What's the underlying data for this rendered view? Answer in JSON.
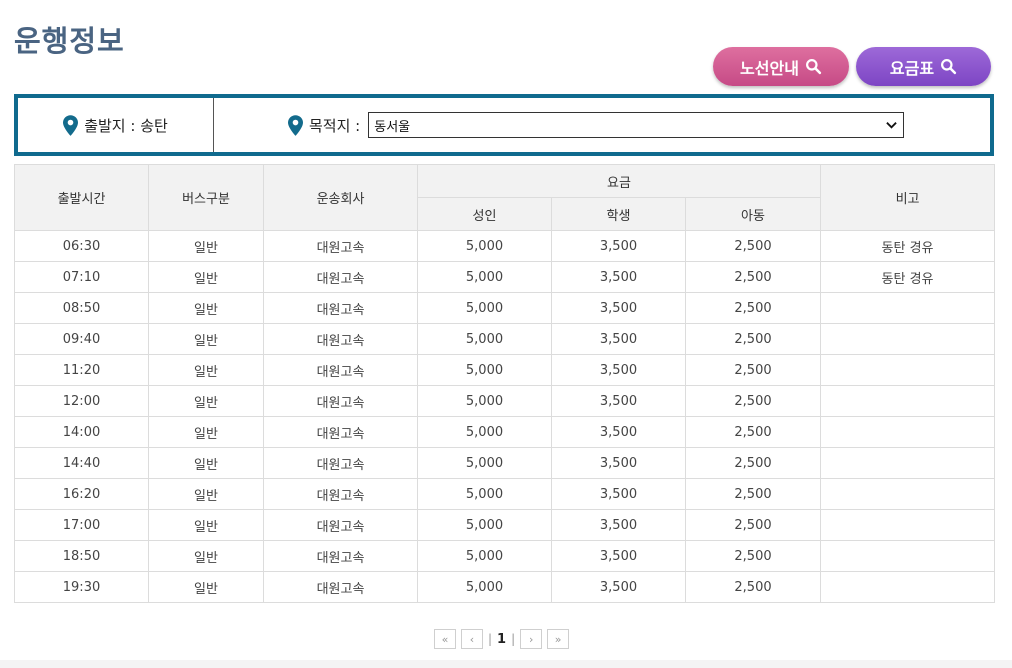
{
  "title": "운행정보",
  "buttons": {
    "route": "노선안내",
    "fare": "요금표"
  },
  "filter": {
    "departure_label": "출발지 : 송탄",
    "destination_label": "목적지 :",
    "destination_value": "동서울"
  },
  "table": {
    "headers": {
      "time": "출발시간",
      "bus_type": "버스구분",
      "company": "운송회사",
      "fare": "요금",
      "adult": "성인",
      "student": "학생",
      "child": "아동",
      "note": "비고"
    },
    "rows": [
      [
        "06:30",
        "일반",
        "대원고속",
        "5,000",
        "3,500",
        "2,500",
        "동탄 경유"
      ],
      [
        "07:10",
        "일반",
        "대원고속",
        "5,000",
        "3,500",
        "2,500",
        "동탄 경유"
      ],
      [
        "08:50",
        "일반",
        "대원고속",
        "5,000",
        "3,500",
        "2,500",
        ""
      ],
      [
        "09:40",
        "일반",
        "대원고속",
        "5,000",
        "3,500",
        "2,500",
        ""
      ],
      [
        "11:20",
        "일반",
        "대원고속",
        "5,000",
        "3,500",
        "2,500",
        ""
      ],
      [
        "12:00",
        "일반",
        "대원고속",
        "5,000",
        "3,500",
        "2,500",
        ""
      ],
      [
        "14:00",
        "일반",
        "대원고속",
        "5,000",
        "3,500",
        "2,500",
        ""
      ],
      [
        "14:40",
        "일반",
        "대원고속",
        "5,000",
        "3,500",
        "2,500",
        ""
      ],
      [
        "16:20",
        "일반",
        "대원고속",
        "5,000",
        "3,500",
        "2,500",
        ""
      ],
      [
        "17:00",
        "일반",
        "대원고속",
        "5,000",
        "3,500",
        "2,500",
        ""
      ],
      [
        "18:50",
        "일반",
        "대원고속",
        "5,000",
        "3,500",
        "2,500",
        ""
      ],
      [
        "19:30",
        "일반",
        "대원고속",
        "5,000",
        "3,500",
        "2,500",
        ""
      ]
    ]
  },
  "pagination": {
    "first": "«",
    "prev": "‹",
    "current": "1",
    "next": "›",
    "last": "»"
  },
  "icons": {
    "pin": "map-pin-icon",
    "search": "search-icon",
    "dropdown": "chevron-down-icon"
  },
  "colors": {
    "title": "#4a6482",
    "filter_border": "#0f6a8e",
    "route_button": "#d05a91",
    "fare_button": "#8a55cc",
    "pin": "#136b8c"
  }
}
